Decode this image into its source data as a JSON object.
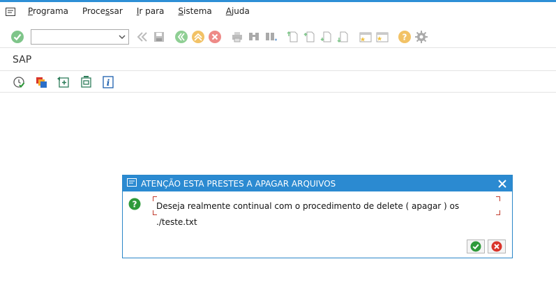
{
  "menu": {
    "items": [
      {
        "pre": "",
        "ul": "P",
        "post": "rograma"
      },
      {
        "pre": "Proce",
        "ul": "s",
        "post": "sar"
      },
      {
        "pre": "",
        "ul": "I",
        "post": "r para"
      },
      {
        "pre": "",
        "ul": "S",
        "post": "istema"
      },
      {
        "pre": "",
        "ul": "A",
        "post": "juda"
      }
    ]
  },
  "toolbar": {
    "command_value": "",
    "icons": [
      "enter-check-icon",
      "back-double-icon",
      "save-icon",
      "back-icon",
      "exit-icon",
      "cancel-icon",
      "print-icon",
      "find-icon",
      "find-next-icon",
      "first-page-icon",
      "previous-page-icon",
      "next-page-icon",
      "last-page-icon",
      "create-session-icon",
      "create-shortcut-icon",
      "help-icon",
      "customize-layout-icon"
    ]
  },
  "screen": {
    "title": "SAP"
  },
  "app_toolbar": {
    "icons": [
      "execute-icon",
      "variants-icon",
      "get-variant-icon",
      "selection-options-icon",
      "info-icon"
    ]
  },
  "dialog": {
    "title": "ATENÇÃO ESTA PRESTES A APAGAR ARQUIVOS",
    "message_line1": "Deseja realmente continual com o procedimento de delete ( apagar ) os",
    "message_line2": "./teste.txt"
  },
  "colors": {
    "accent": "#2b8ad1",
    "ok_green": "#2e9a3a",
    "cancel_red": "#d9352b"
  }
}
